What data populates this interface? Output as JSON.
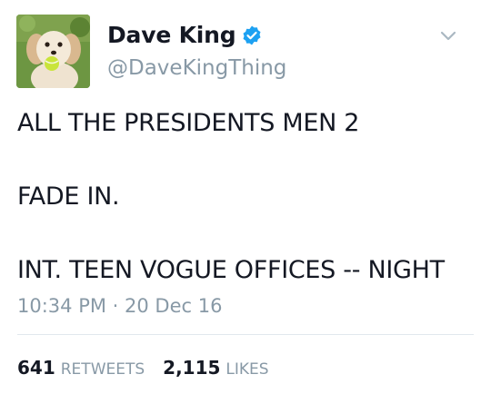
{
  "author": {
    "display_name": "Dave King",
    "handle": "@DaveKingThing",
    "verified": true,
    "avatar_icon": "dog-with-tennis-ball-avatar"
  },
  "tweet": {
    "lines": [
      "ALL THE PRESIDENTS MEN 2",
      "FADE IN.",
      "INT. TEEN VOGUE OFFICES -- NIGHT"
    ],
    "timestamp": "10:34 PM · 20 Dec 16"
  },
  "stats": {
    "retweets_count": "641",
    "retweets_label": "RETWEETS",
    "likes_count": "2,115",
    "likes_label": "LIKES"
  },
  "colors": {
    "verified_blue": "#1da1f2",
    "secondary_text": "#8899a6",
    "primary_text": "#141823",
    "divider": "#e1e8ed"
  }
}
